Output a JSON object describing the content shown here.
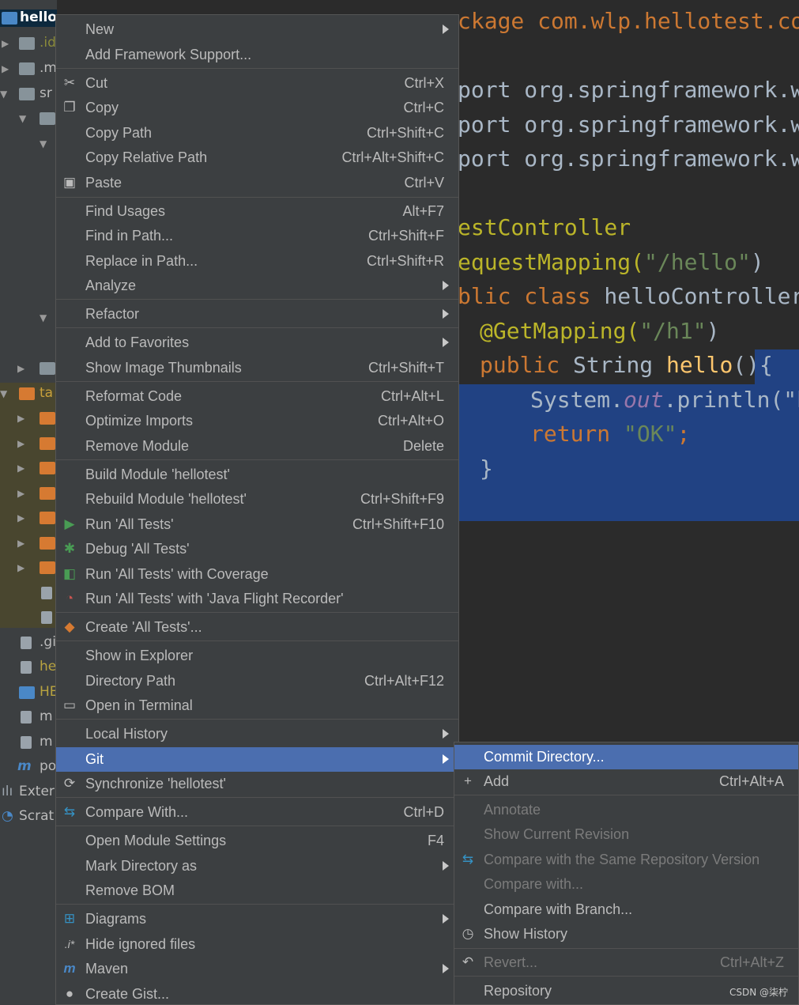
{
  "tree": {
    "rows": [
      "hello",
      ".id",
      ".m",
      "sr",
      "ta",
      ".gi",
      "he",
      "HE",
      "m",
      "m",
      "po",
      "Exter",
      "Scrat"
    ]
  },
  "editor": {
    "lines": {
      "l1": "ckage com.wlp.hellotest.con",
      "l2": "port org.springframework.we",
      "l3": "port org.springframework.we",
      "l4": "port org.springframework.we",
      "l5": "estController",
      "l6a": "equestMapping(",
      "l6b": "\"/hello\"",
      "l6c": ")",
      "l7a": "blic class",
      "l7b": " helloController ",
      "l8a": "@GetMapping(",
      "l8b": "\"/h1\"",
      "l8c": ")",
      "l9a": "public",
      "l9b": " String ",
      "l9c": "hello",
      "l9d": "(){",
      "l10a": "System.",
      "l10b": "out",
      "l10c": ".println(\"h",
      "l11a": "return",
      "l11b": " \"OK\"",
      "l11c": ";",
      "l12": "}"
    }
  },
  "main_menu": {
    "items": [
      {
        "label": "New",
        "shortcut": "",
        "submenu": true
      },
      {
        "label": "Add Framework Support...",
        "shortcut": ""
      },
      {
        "label": "Cut",
        "shortcut": "Ctrl+X",
        "icon": "cut-icon"
      },
      {
        "label": "Copy",
        "shortcut": "Ctrl+C",
        "icon": "copy-icon"
      },
      {
        "label": "Copy Path",
        "shortcut": "Ctrl+Shift+C"
      },
      {
        "label": "Copy Relative Path",
        "shortcut": "Ctrl+Alt+Shift+C"
      },
      {
        "label": "Paste",
        "shortcut": "Ctrl+V",
        "icon": "paste-icon"
      },
      {
        "label": "Find Usages",
        "shortcut": "Alt+F7"
      },
      {
        "label": "Find in Path...",
        "shortcut": "Ctrl+Shift+F"
      },
      {
        "label": "Replace in Path...",
        "shortcut": "Ctrl+Shift+R"
      },
      {
        "label": "Analyze",
        "shortcut": "",
        "submenu": true
      },
      {
        "label": "Refactor",
        "shortcut": "",
        "submenu": true
      },
      {
        "label": "Add to Favorites",
        "shortcut": "",
        "submenu": true
      },
      {
        "label": "Show Image Thumbnails",
        "shortcut": "Ctrl+Shift+T"
      },
      {
        "label": "Reformat Code",
        "shortcut": "Ctrl+Alt+L"
      },
      {
        "label": "Optimize Imports",
        "shortcut": "Ctrl+Alt+O"
      },
      {
        "label": "Remove Module",
        "shortcut": "Delete"
      },
      {
        "label": "Build Module 'hellotest'",
        "shortcut": ""
      },
      {
        "label": "Rebuild Module 'hellotest'",
        "shortcut": "Ctrl+Shift+F9"
      },
      {
        "label": "Run 'All Tests'",
        "shortcut": "Ctrl+Shift+F10",
        "icon": "run-icon"
      },
      {
        "label": "Debug 'All Tests'",
        "shortcut": "",
        "icon": "debug-icon"
      },
      {
        "label": "Run 'All Tests' with Coverage",
        "shortcut": "",
        "icon": "coverage-icon"
      },
      {
        "label": "Run 'All Tests' with 'Java Flight Recorder'",
        "shortcut": "",
        "icon": "profiler-icon"
      },
      {
        "label": "Create 'All Tests'...",
        "shortcut": "",
        "icon": "create-test-icon"
      },
      {
        "label": "Show in Explorer",
        "shortcut": ""
      },
      {
        "label": "Directory Path",
        "shortcut": "Ctrl+Alt+F12"
      },
      {
        "label": "Open in Terminal",
        "shortcut": "",
        "icon": "terminal-icon"
      },
      {
        "label": "Local History",
        "shortcut": "",
        "submenu": true
      },
      {
        "label": "Git",
        "shortcut": "",
        "submenu": true
      },
      {
        "label": "Synchronize 'hellotest'",
        "shortcut": "",
        "icon": "sync-icon"
      },
      {
        "label": "Compare With...",
        "shortcut": "Ctrl+D",
        "icon": "compare-icon"
      },
      {
        "label": "Open Module Settings",
        "shortcut": "F4"
      },
      {
        "label": "Mark Directory as",
        "shortcut": "",
        "submenu": true
      },
      {
        "label": "Remove BOM",
        "shortcut": ""
      },
      {
        "label": "Diagrams",
        "shortcut": "",
        "submenu": true,
        "icon": "diagram-icon"
      },
      {
        "label": "Hide ignored files",
        "shortcut": "",
        "icon": "ignored-files-icon"
      },
      {
        "label": "Maven",
        "shortcut": "",
        "submenu": true,
        "icon": "maven-icon"
      },
      {
        "label": "Create Gist...",
        "shortcut": "",
        "icon": "github-icon"
      }
    ]
  },
  "git_menu": {
    "items": [
      {
        "label": "Commit Directory...",
        "shortcut": ""
      },
      {
        "label": "Add",
        "shortcut": "Ctrl+Alt+A",
        "icon": "plus-icon"
      },
      {
        "label": "Annotate",
        "shortcut": ""
      },
      {
        "label": "Show Current Revision",
        "shortcut": ""
      },
      {
        "label": "Compare with the Same Repository Version",
        "shortcut": "",
        "icon": "compare-icon"
      },
      {
        "label": "Compare with...",
        "shortcut": ""
      },
      {
        "label": "Compare with Branch...",
        "shortcut": ""
      },
      {
        "label": "Show History",
        "shortcut": "",
        "icon": "history-icon"
      },
      {
        "label": "Revert...",
        "shortcut": "Ctrl+Alt+Z",
        "icon": "revert-icon"
      },
      {
        "label": "Repository",
        "shortcut": ""
      }
    ]
  },
  "watermark": "CSDN @柒柠",
  "colors": {
    "menu_bg": "#3c3f41",
    "active_bg": "#4b6eaf",
    "editor_bg": "#2b2b2b",
    "selection_bg": "#214283"
  }
}
